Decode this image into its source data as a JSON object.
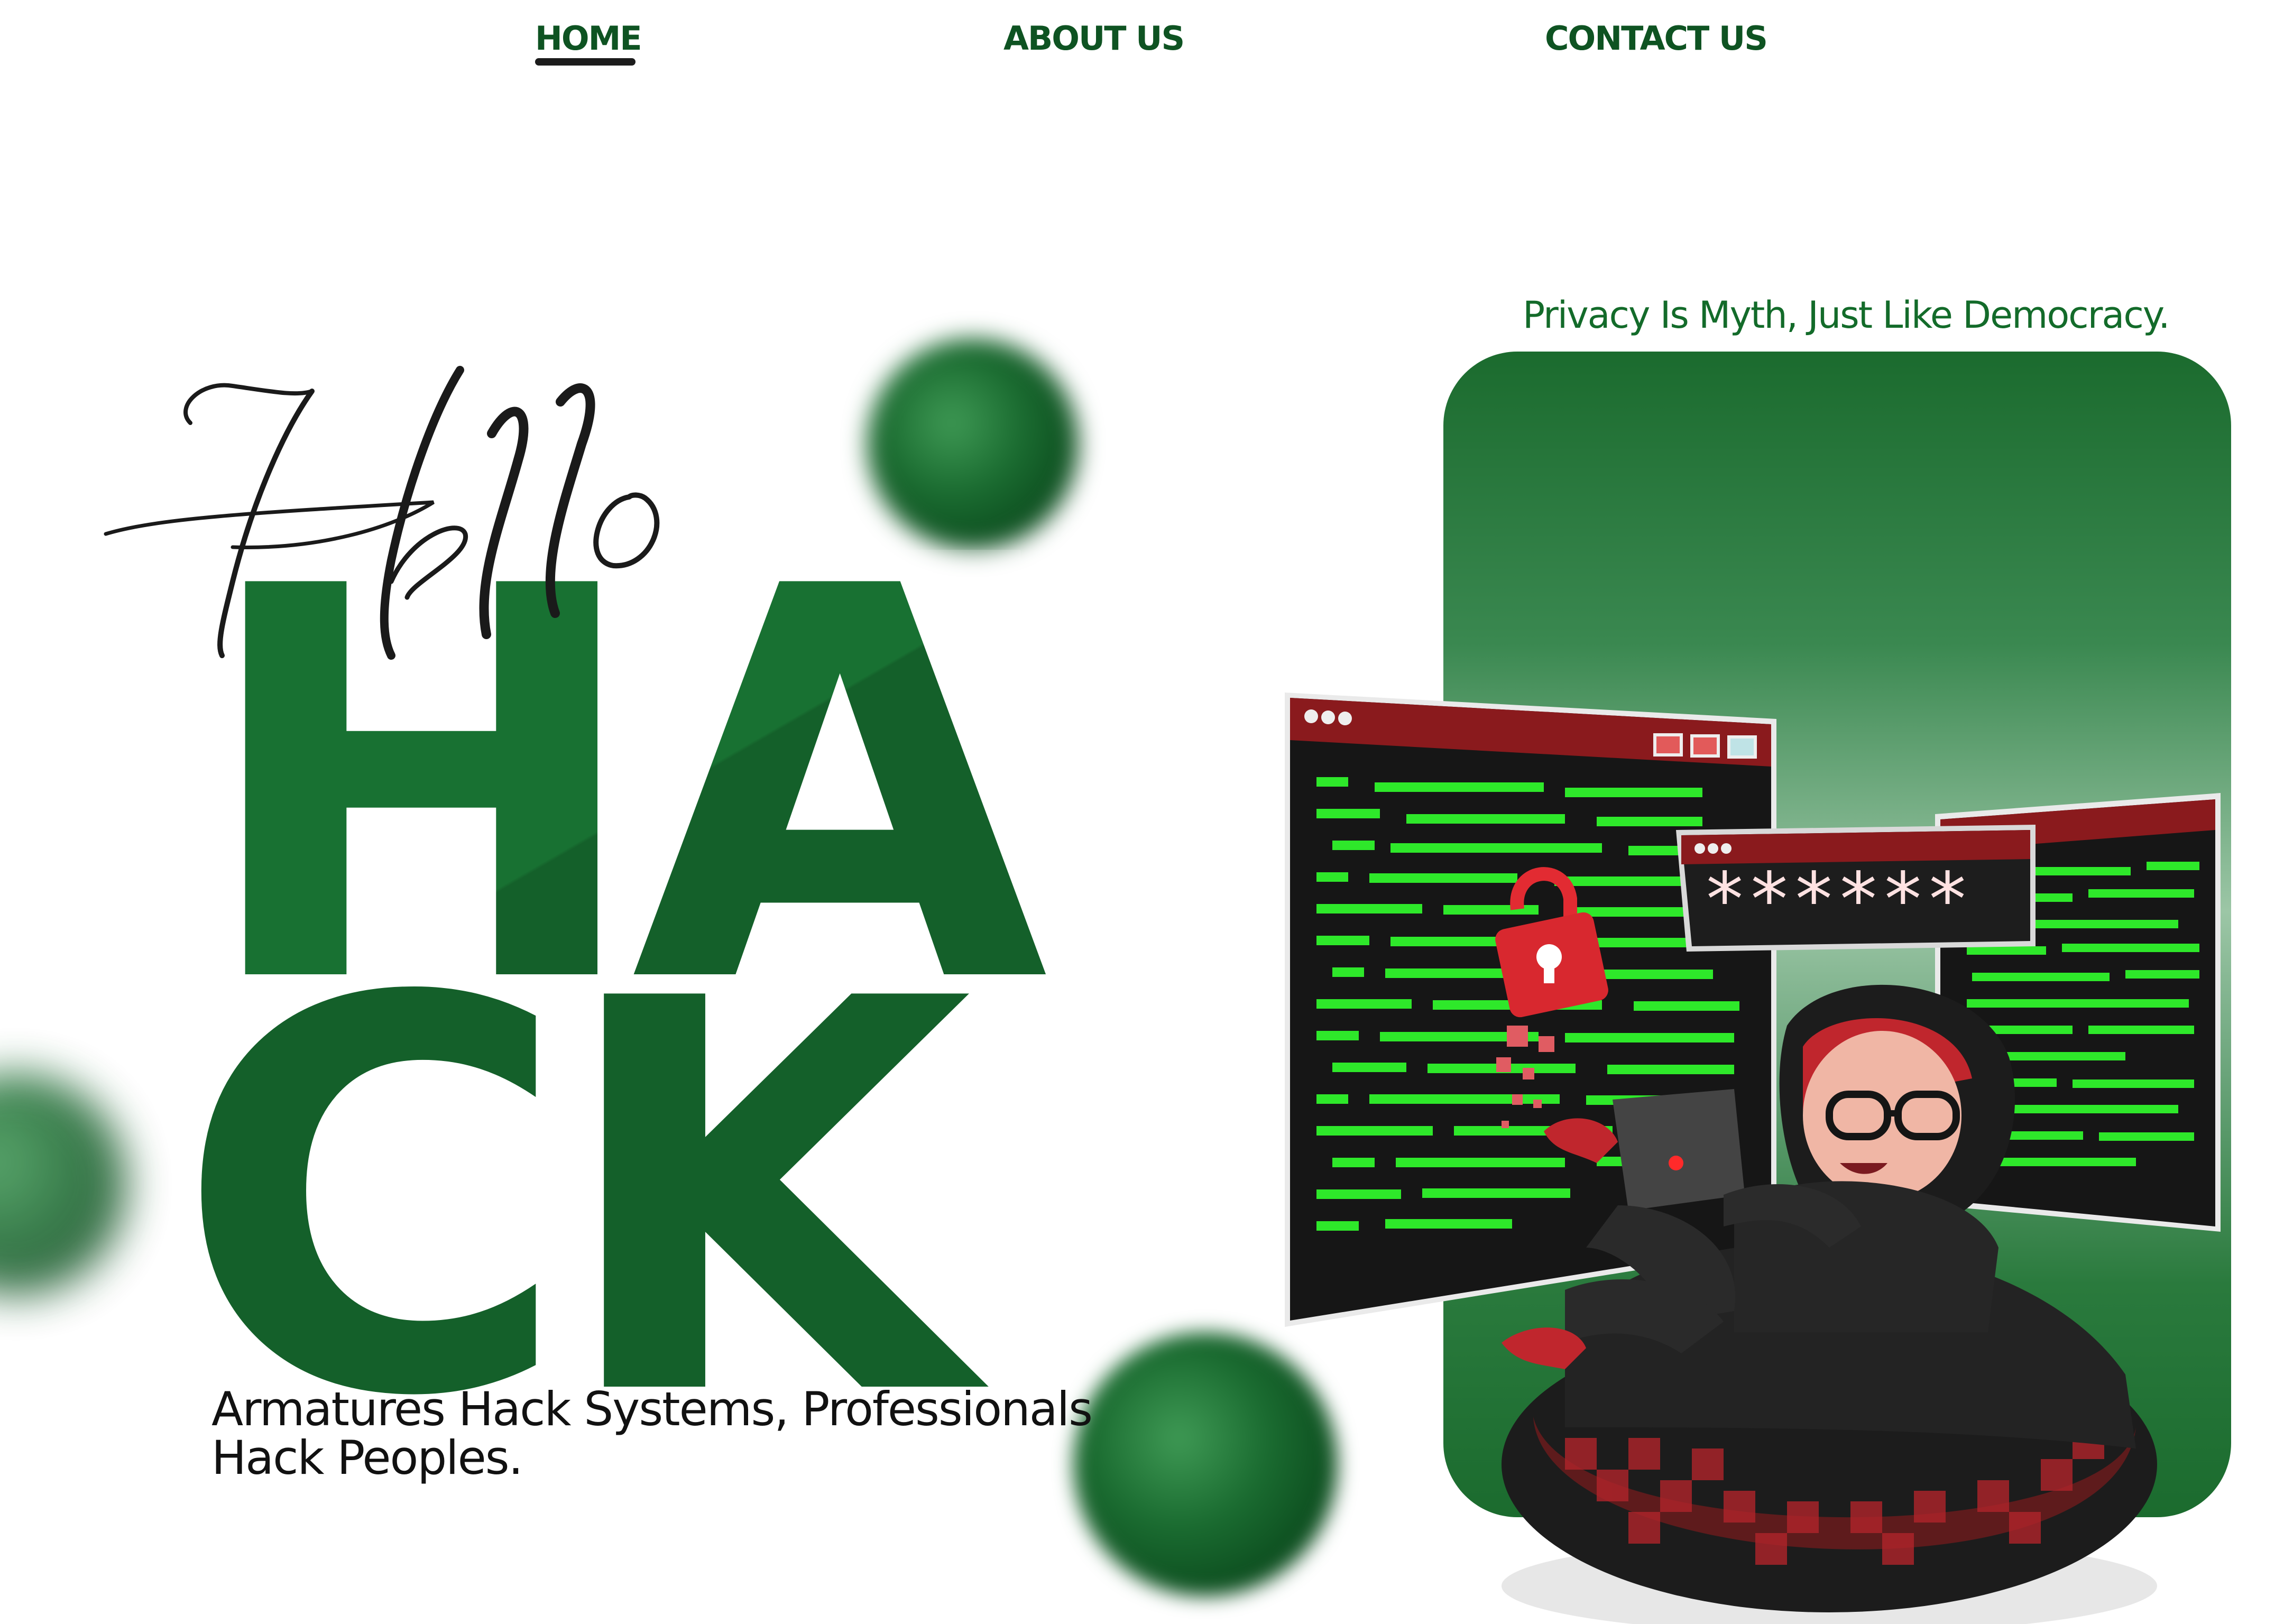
{
  "nav": {
    "items": [
      {
        "label": "HOME",
        "active": true
      },
      {
        "label": "ABOUT US",
        "active": false
      },
      {
        "label": "CONTACT US",
        "active": false
      }
    ]
  },
  "hero": {
    "script_word": "Hello",
    "big_line_1": "HA",
    "big_line_2": "CK",
    "tagline": "Armatures Hack Systems, Professionals Hack Peoples."
  },
  "quote": "Privacy Is Myth, Just Like Democracy.",
  "illustration": {
    "password_mask": "******"
  },
  "colors": {
    "primary_green": "#14602a",
    "nav_green": "#0e5322",
    "code_green": "#2ee82a",
    "accent_red": "#c0262d"
  }
}
